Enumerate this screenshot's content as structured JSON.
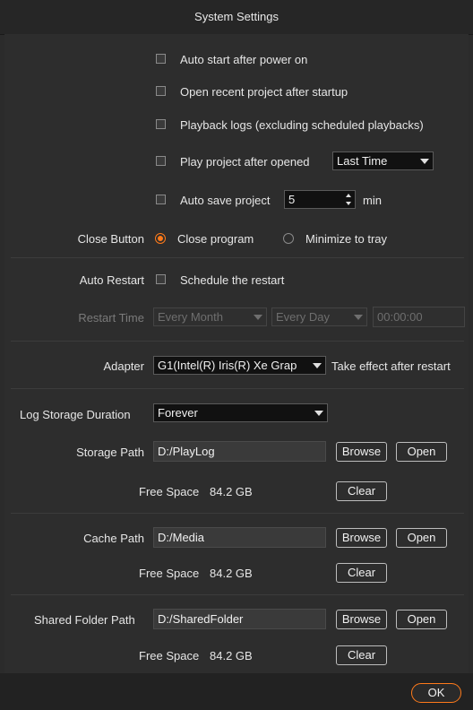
{
  "window": {
    "title": "System Settings"
  },
  "startup": {
    "auto_start": "Auto start after power on",
    "open_recent": "Open recent project after startup",
    "playback_logs": "Playback logs (excluding scheduled playbacks)",
    "play_after_opened": "Play project after opened",
    "play_after_opened_option": "Last Time",
    "auto_save": "Auto save project",
    "auto_save_value": "5",
    "auto_save_unit": "min"
  },
  "close_button": {
    "label": "Close Button",
    "option_close": "Close program",
    "option_minimize": "Minimize to tray",
    "selected": "Close program"
  },
  "auto_restart": {
    "label": "Auto Restart",
    "schedule": "Schedule the restart",
    "restart_time_label": "Restart Time",
    "month_option": "Every Month",
    "day_option": "Every Day",
    "time_value": "00:00:00"
  },
  "adapter": {
    "label": "Adapter",
    "value": "G1(Intel(R) Iris(R) Xe Grap",
    "note": "Take effect after restart"
  },
  "log": {
    "duration_label": "Log Storage Duration",
    "duration_value": "Forever",
    "storage_path_label": "Storage Path",
    "storage_path_value": "D:/PlayLog",
    "browse": "Browse",
    "open": "Open",
    "free_space_label": "Free Space",
    "free_space_value": "84.2 GB",
    "clear": "Clear"
  },
  "cache": {
    "path_label": "Cache Path",
    "path_value": "D:/Media",
    "browse": "Browse",
    "open": "Open",
    "free_space_label": "Free Space",
    "free_space_value": "84.2 GB",
    "clear": "Clear"
  },
  "shared": {
    "path_label": "Shared Folder Path",
    "path_value": "D:/SharedFolder",
    "browse": "Browse",
    "open": "Open",
    "free_space_label": "Free Space",
    "free_space_value": "84.2 GB",
    "clear": "Clear"
  },
  "footer": {
    "ok": "OK"
  },
  "colors": {
    "accent": "#ff7a1a",
    "background": "#2d2d2d"
  }
}
